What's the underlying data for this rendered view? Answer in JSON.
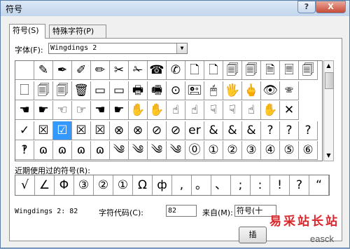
{
  "window": {
    "title": "符号",
    "help_label": "?",
    "close_label": "X"
  },
  "tabs": [
    {
      "label": "符号(S)",
      "active": true
    },
    {
      "label": "特殊字符(P)",
      "active": false
    }
  ],
  "font": {
    "label": "字体(F):",
    "value": "Wingdings 2"
  },
  "symbols": [
    [
      " ",
      "✎",
      "✒",
      "✐",
      "✏",
      "✂",
      "✁",
      "☎",
      "✆",
      "🗋",
      "🗋",
      "🗐",
      "🗐",
      "🗎",
      "🗏",
      "🗐"
    ],
    [
      "🗌",
      "🗐",
      "🗐",
      "🗑",
      "▭",
      "▭",
      "🖶",
      "🖷",
      "⊙",
      "🖭",
      "🖱",
      "🖐",
      "🖕",
      "👁",
      "🕾"
    ],
    [
      "☚",
      "☛",
      "☜",
      "☞",
      "☚",
      "☛",
      "✋",
      "✋",
      "☝",
      "☝",
      "☟",
      "☟",
      "☝",
      "✋",
      "✕"
    ],
    [
      "✓",
      "☒",
      "☑",
      "☒",
      "☒",
      "⊗",
      "⊗",
      "⊘",
      "⊘",
      "er",
      "&",
      "&",
      "&",
      "?",
      "?",
      "?"
    ],
    [
      "‽",
      "ɷ",
      "ɷ",
      "ɷ",
      "ɷ",
      "༄",
      "༄",
      "༄",
      "༄",
      "⓪",
      "①",
      "②",
      "③",
      "④",
      "⑤",
      "⑥"
    ]
  ],
  "selected_symbol": "☑",
  "recent": {
    "label": "近期使用过的符号(R):",
    "symbols": [
      "√",
      "∠",
      "Φ",
      "③",
      "②",
      "①",
      "Ω",
      "ф",
      ",",
      "。",
      "、",
      ";",
      ":",
      "!",
      "?",
      "“"
    ]
  },
  "status": {
    "char_name": "Wingdings 2: 82",
    "code_label": "字符代码(C):",
    "code_value": "82",
    "from_label": "来自(M):",
    "from_value": "符号(十"
  },
  "buttons": {
    "insert_label": "插"
  },
  "watermark": {
    "text": "易采站长站",
    "sub": "easck"
  },
  "colors": {
    "selection": "#3399ff",
    "close": "#c74a36"
  }
}
